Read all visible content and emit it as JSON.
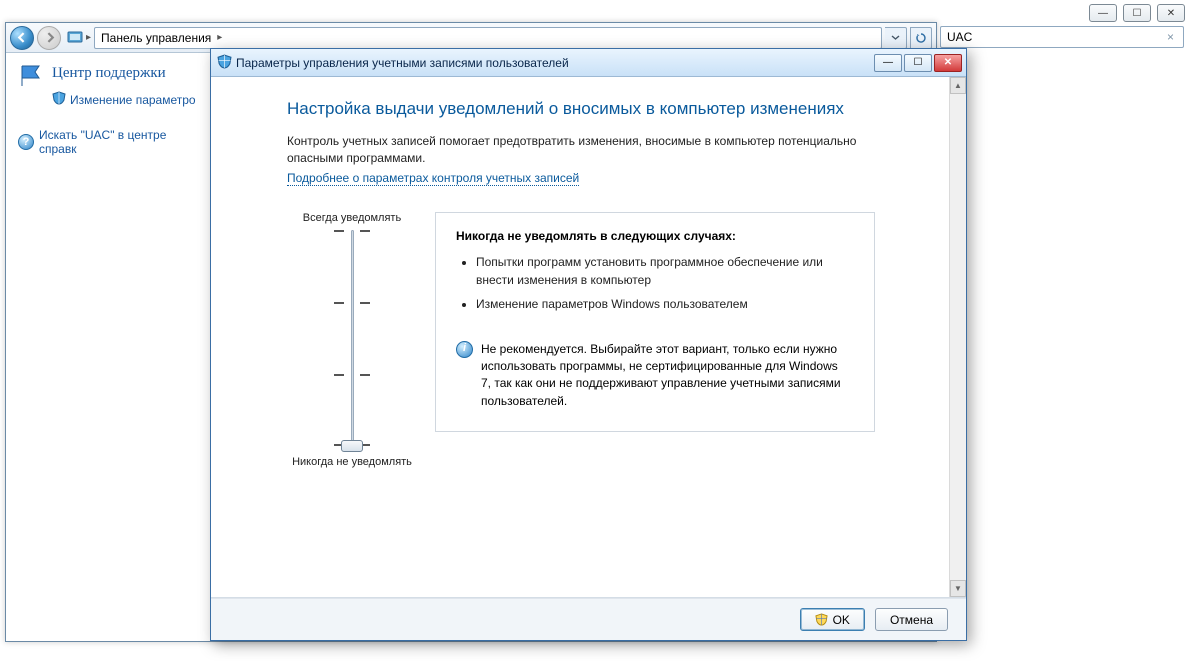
{
  "frame": {
    "min": "—",
    "max": "☐",
    "close": "✕"
  },
  "explorer": {
    "path_prefix": "▸",
    "path": "Панель управления",
    "path_sep": "▸",
    "sidebar": {
      "title": "Центр поддержки",
      "subtitle": "Изменение параметро",
      "help_label": "Искать \"UAC\" в центре справк"
    }
  },
  "search": {
    "value": "UAC",
    "close": "×"
  },
  "dialog": {
    "title": "Параметры управления учетными записями пользователей",
    "heading": "Настройка выдачи уведомлений о вносимых в компьютер изменениях",
    "desc": "Контроль учетных записей помогает предотвратить изменения, вносимые в компьютер потенциально опасными программами.",
    "link": "Подробнее о параметрах контроля учетных записей",
    "slider": {
      "top_label": "Всегда уведомлять",
      "bottom_label": "Никогда не уведомлять",
      "level": 0
    },
    "panel": {
      "heading": "Никогда не уведомлять в следующих случаях:",
      "items": [
        "Попытки программ установить программное обеспечение или внести изменения в компьютер",
        "Изменение параметров Windows пользователем"
      ],
      "note": "Не рекомендуется. Выбирайте этот вариант, только если нужно использовать программы, не сертифицированные для Windows 7, так как они не поддерживают управление учетными записями пользователей."
    },
    "buttons": {
      "ok": "OK",
      "cancel": "Отмена"
    },
    "win": {
      "min": "—",
      "max": "☐",
      "close": "✕"
    }
  }
}
